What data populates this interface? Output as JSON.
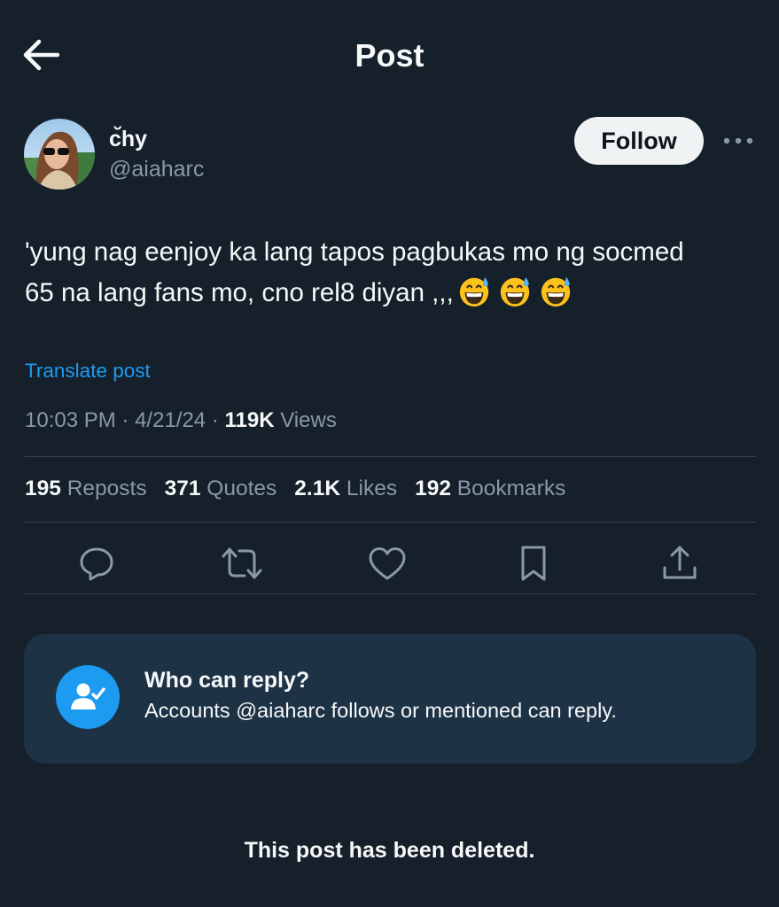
{
  "header": {
    "title": "Post",
    "back_icon": "arrow-left-icon"
  },
  "author": {
    "display_name": "c̆hy",
    "handle": "@aiaharc",
    "follow_label": "Follow",
    "more_icon": "more-horizontal-icon"
  },
  "post": {
    "text_line1": "'yung nag eenjoy ka lang tapos pagbukas mo ng socmed",
    "text_line2": "65 na lang fans mo, cno rel8 diyan ,,,",
    "emojis": [
      "grinning-face-with-sweat",
      "grinning-face-with-sweat",
      "grinning-face-with-sweat"
    ],
    "translate_label": "Translate post",
    "time": "10:03 PM",
    "date": "4/21/24",
    "views_count": "119K",
    "views_label": "Views"
  },
  "stats": {
    "reposts_count": "195",
    "reposts_label": "Reposts",
    "quotes_count": "371",
    "quotes_label": "Quotes",
    "likes_count": "2.1K",
    "likes_label": "Likes",
    "bookmarks_count": "192",
    "bookmarks_label": "Bookmarks"
  },
  "actions": [
    "reply-icon",
    "repost-icon",
    "like-icon",
    "bookmark-icon",
    "share-icon"
  ],
  "reply_settings": {
    "title": "Who can reply?",
    "description": "Accounts @aiaharc follows or mentioned can reply.",
    "icon": "user-check-icon"
  },
  "footer": {
    "deleted_notice": "This post has been deleted."
  },
  "colors": {
    "background": "#15202b",
    "accent": "#1d9bf0",
    "secondary_text": "#8b98a5",
    "card": "#1e3246"
  }
}
